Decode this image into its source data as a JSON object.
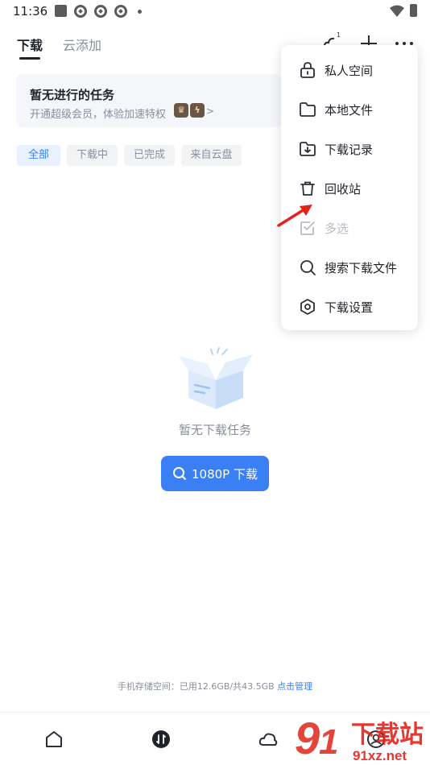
{
  "status_bar": {
    "time": "11:36"
  },
  "top_tabs": [
    {
      "label": "下载",
      "active": true
    },
    {
      "label": "云添加",
      "active": false
    }
  ],
  "top_actions": {
    "cloud_badge": "1"
  },
  "banner": {
    "title": "暂无进行的任务",
    "subtitle": "开通超级会员，体验加速特权",
    "chevron": ">"
  },
  "filters": [
    {
      "label": "全部",
      "active": true
    },
    {
      "label": "下载中",
      "active": false
    },
    {
      "label": "已完成",
      "active": false
    },
    {
      "label": "来自云盘",
      "active": false
    }
  ],
  "empty_state": {
    "text": "暂无下载任务",
    "button_label": "1080P 下载"
  },
  "storage": {
    "text": "手机存储空间：已用12.6GB/共43.5GB",
    "link": "点击管理"
  },
  "menu": {
    "items": [
      {
        "label": "私人空间",
        "icon": "lock-icon",
        "enabled": true
      },
      {
        "label": "本地文件",
        "icon": "folder-icon",
        "enabled": true
      },
      {
        "label": "下载记录",
        "icon": "download-folder-icon",
        "enabled": true
      },
      {
        "label": "回收站",
        "icon": "trash-icon",
        "enabled": true
      },
      {
        "label": "多选",
        "icon": "checkbox-icon",
        "enabled": false
      },
      {
        "label": "搜索下载文件",
        "icon": "search-icon",
        "enabled": true
      },
      {
        "label": "下载设置",
        "icon": "hexagon-settings-icon",
        "enabled": true
      }
    ]
  },
  "watermark": {
    "brand": "下载站",
    "domain": "91xz.net"
  },
  "colors": {
    "accent": "#3b7ff5",
    "text_primary": "#1f2329",
    "text_secondary": "#8a8f99",
    "annotation_arrow": "#e2231a"
  }
}
